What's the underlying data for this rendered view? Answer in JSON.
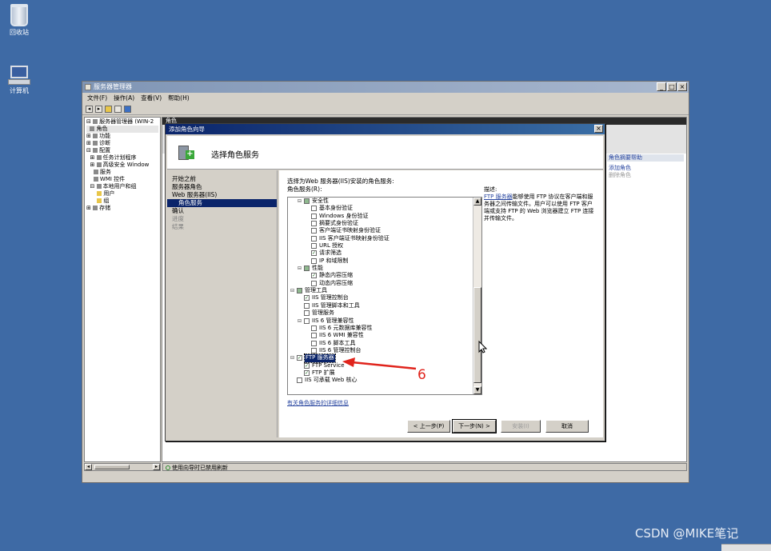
{
  "desktop": {
    "icons": [
      {
        "label": "回收站"
      },
      {
        "label": "计算机"
      }
    ],
    "watermark": "CSDN @MIKE笔记"
  },
  "server_manager": {
    "title": "服务器管理器",
    "menu": [
      "文件(F)",
      "操作(A)",
      "查看(V)",
      "帮助(H)"
    ],
    "tree": [
      "服务器管理器 (WIN-2",
      "角色",
      "功能",
      "诊断",
      "配置",
      "任务计划程序",
      "高级安全 Window",
      "服务",
      "WMI 控件",
      "本地用户和组",
      "用户",
      "组",
      "存储"
    ],
    "pane_header": "角色",
    "actions": {
      "header": "角色摘要帮助",
      "items": [
        "添加角色",
        "删除角色"
      ]
    },
    "status": "使用向导时已禁用刷新"
  },
  "wizard": {
    "title": "添加角色向导",
    "heading": "选择角色服务",
    "nav": [
      "开始之前",
      "服务器角色",
      "Web 服务器(IIS)",
      "角色服务",
      "确认",
      "进度",
      "结果"
    ],
    "prompt": "选择为Web 服务器(IIS)安装的角色服务:",
    "list_label": "角色服务(R):",
    "services": [
      {
        "label": "安全性",
        "checked": "partial"
      },
      {
        "label": "基本身份验证",
        "checked": "no"
      },
      {
        "label": "Windows 身份验证",
        "checked": "no"
      },
      {
        "label": "摘要式身份验证",
        "checked": "no"
      },
      {
        "label": "客户端证书映射身份验证",
        "checked": "no"
      },
      {
        "label": "IIS 客户端证书映射身份验证",
        "checked": "no"
      },
      {
        "label": "URL 授权",
        "checked": "no"
      },
      {
        "label": "请求筛选",
        "checked": "yes"
      },
      {
        "label": "IP 和域限制",
        "checked": "no"
      },
      {
        "label": "性能",
        "checked": "partial"
      },
      {
        "label": "静态内容压缩",
        "checked": "yes"
      },
      {
        "label": "动态内容压缩",
        "checked": "no"
      },
      {
        "label": "管理工具",
        "checked": "partial"
      },
      {
        "label": "IIS 管理控制台",
        "checked": "yes"
      },
      {
        "label": "IIS 管理脚本和工具",
        "checked": "no"
      },
      {
        "label": "管理服务",
        "checked": "no"
      },
      {
        "label": "IIS 6 管理兼容性",
        "checked": "no"
      },
      {
        "label": "IIS 6 元数据库兼容性",
        "checked": "no"
      },
      {
        "label": "IIS 6 WMI 兼容性",
        "checked": "no"
      },
      {
        "label": "IIS 6 脚本工具",
        "checked": "no"
      },
      {
        "label": "IIS 6 管理控制台",
        "checked": "no"
      },
      {
        "label": "FTP 服务器",
        "checked": "yes"
      },
      {
        "label": "FTP Service",
        "checked": "yes"
      },
      {
        "label": "FTP 扩展",
        "checked": "yes"
      },
      {
        "label": "IIS 可承载 Web 核心",
        "checked": "no"
      }
    ],
    "description_label": "描述:",
    "description_link": "FTP 服务器",
    "description_text": "能够使用 FTP 协议在客户端和服务器之间传输文件。用户可以使用 FTP 客户端或支持 FTP 的 Web 浏览器建立 FTP 连接并传输文件。",
    "more_info_link": "有关角色服务的详细信息",
    "buttons": {
      "back": "< 上一步(P)",
      "next": "下一步(N) >",
      "install": "安装(I)",
      "cancel": "取消"
    }
  },
  "annotation": {
    "number": "6",
    "color": "#e0241c"
  }
}
